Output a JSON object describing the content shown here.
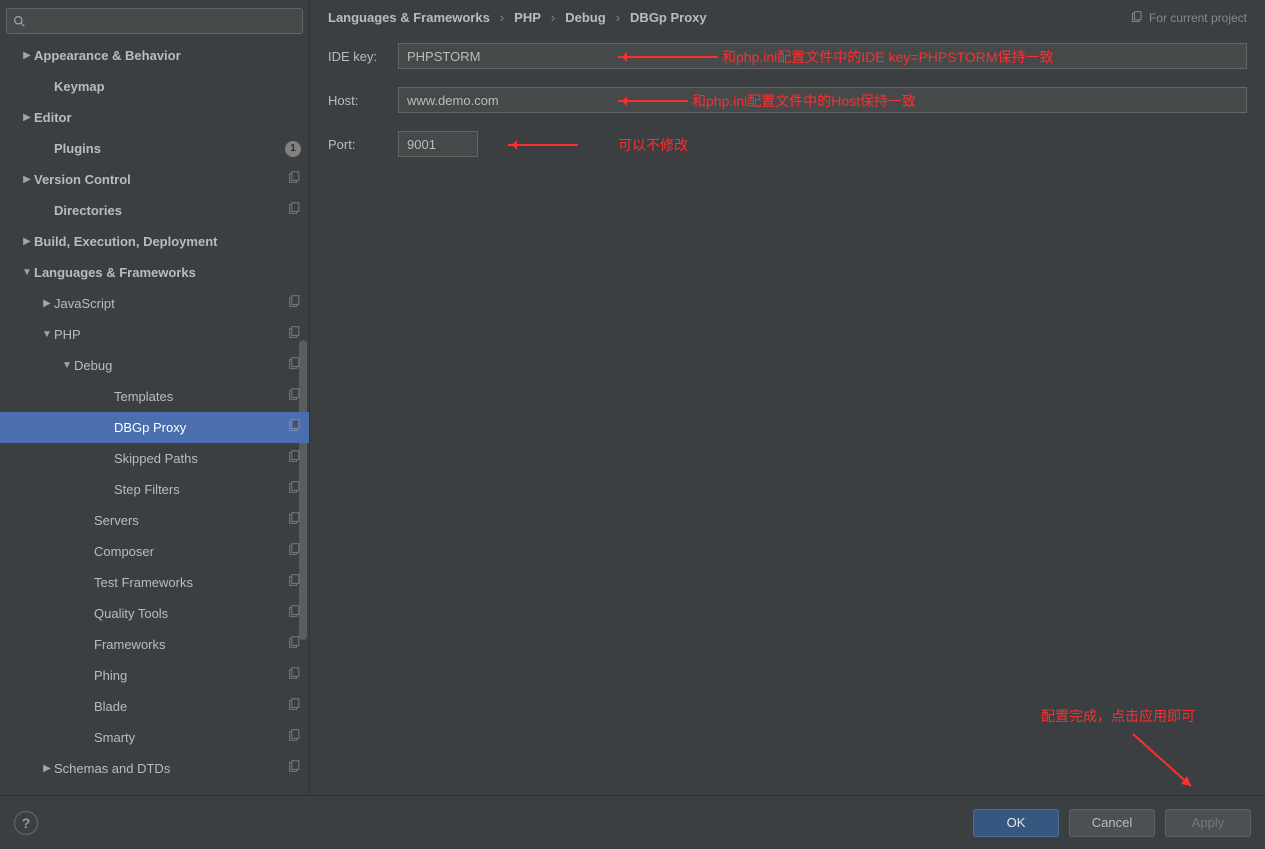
{
  "search": {
    "placeholder": ""
  },
  "tree": [
    {
      "label": "Appearance & Behavior",
      "indent": 20,
      "arrow": "right",
      "bold": true,
      "copy": false,
      "badge": null
    },
    {
      "label": "Keymap",
      "indent": 40,
      "arrow": "",
      "bold": true,
      "copy": false,
      "badge": null
    },
    {
      "label": "Editor",
      "indent": 20,
      "arrow": "right",
      "bold": true,
      "copy": false,
      "badge": null
    },
    {
      "label": "Plugins",
      "indent": 40,
      "arrow": "",
      "bold": true,
      "copy": false,
      "badge": "1"
    },
    {
      "label": "Version Control",
      "indent": 20,
      "arrow": "right",
      "bold": true,
      "copy": true,
      "badge": null
    },
    {
      "label": "Directories",
      "indent": 40,
      "arrow": "",
      "bold": true,
      "copy": true,
      "badge": null
    },
    {
      "label": "Build, Execution, Deployment",
      "indent": 20,
      "arrow": "right",
      "bold": true,
      "copy": false,
      "badge": null
    },
    {
      "label": "Languages & Frameworks",
      "indent": 20,
      "arrow": "down",
      "bold": true,
      "copy": false,
      "badge": null
    },
    {
      "label": "JavaScript",
      "indent": 40,
      "arrow": "right",
      "bold": false,
      "copy": true,
      "badge": null
    },
    {
      "label": "PHP",
      "indent": 40,
      "arrow": "down",
      "bold": false,
      "copy": true,
      "badge": null
    },
    {
      "label": "Debug",
      "indent": 60,
      "arrow": "down",
      "bold": false,
      "copy": true,
      "badge": null
    },
    {
      "label": "Templates",
      "indent": 100,
      "arrow": "",
      "bold": false,
      "copy": true,
      "badge": null
    },
    {
      "label": "DBGp Proxy",
      "indent": 100,
      "arrow": "",
      "bold": false,
      "copy": true,
      "badge": null,
      "selected": true
    },
    {
      "label": "Skipped Paths",
      "indent": 100,
      "arrow": "",
      "bold": false,
      "copy": true,
      "badge": null
    },
    {
      "label": "Step Filters",
      "indent": 100,
      "arrow": "",
      "bold": false,
      "copy": true,
      "badge": null
    },
    {
      "label": "Servers",
      "indent": 80,
      "arrow": "",
      "bold": false,
      "copy": true,
      "badge": null
    },
    {
      "label": "Composer",
      "indent": 80,
      "arrow": "",
      "bold": false,
      "copy": true,
      "badge": null
    },
    {
      "label": "Test Frameworks",
      "indent": 80,
      "arrow": "",
      "bold": false,
      "copy": true,
      "badge": null
    },
    {
      "label": "Quality Tools",
      "indent": 80,
      "arrow": "",
      "bold": false,
      "copy": true,
      "badge": null
    },
    {
      "label": "Frameworks",
      "indent": 80,
      "arrow": "",
      "bold": false,
      "copy": true,
      "badge": null
    },
    {
      "label": "Phing",
      "indent": 80,
      "arrow": "",
      "bold": false,
      "copy": true,
      "badge": null
    },
    {
      "label": "Blade",
      "indent": 80,
      "arrow": "",
      "bold": false,
      "copy": true,
      "badge": null
    },
    {
      "label": "Smarty",
      "indent": 80,
      "arrow": "",
      "bold": false,
      "copy": true,
      "badge": null
    },
    {
      "label": "Schemas and DTDs",
      "indent": 40,
      "arrow": "right",
      "bold": false,
      "copy": true,
      "badge": null
    }
  ],
  "breadcrumbs": [
    "Languages & Frameworks",
    "PHP",
    "Debug",
    "DBGp Proxy"
  ],
  "projectScope": "For current project",
  "form": {
    "ideKeyLabel": "IDE key:",
    "ideKeyValue": "PHPSTORM",
    "hostLabel": "Host:",
    "hostValue": "www.demo.com",
    "portLabel": "Port:",
    "portValue": "9001"
  },
  "annotations": {
    "ideKey": "和php.ini配置文件中的IDE key=PHPSTORM保持一致",
    "host": "和php.ini配置文件中的Host保持一致",
    "port": "可以不修改",
    "apply": "配置完成，点击应用即可"
  },
  "footer": {
    "help": "?",
    "ok": "OK",
    "cancel": "Cancel",
    "apply": "Apply"
  }
}
